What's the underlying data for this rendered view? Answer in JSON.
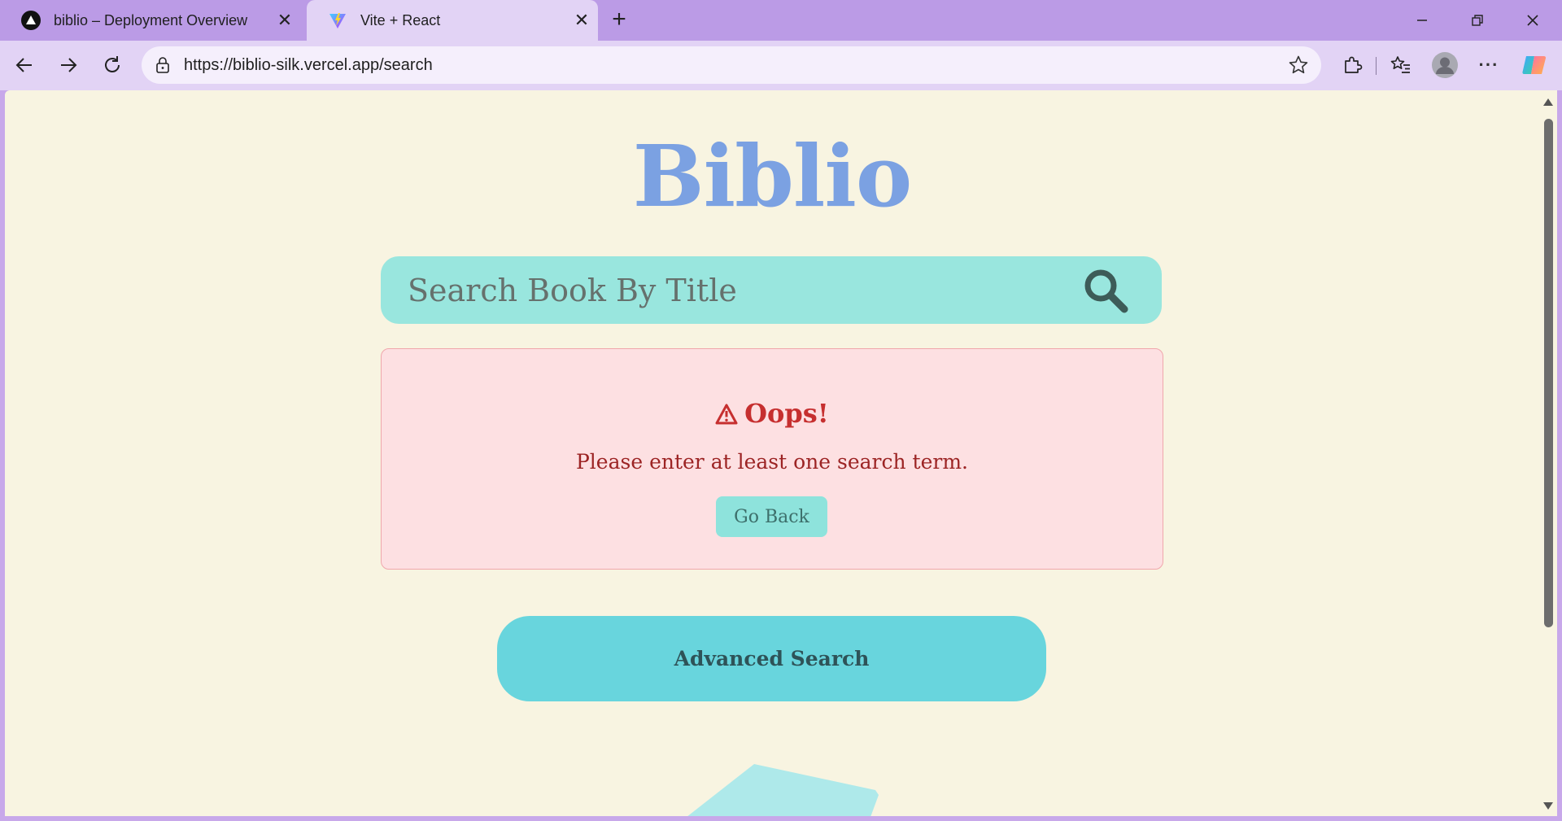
{
  "browser": {
    "tabs": [
      {
        "title": "biblio – Deployment Overview",
        "favicon": "vercel-triangle-icon",
        "active": false
      },
      {
        "title": "Vite + React",
        "favicon": "vite-icon",
        "active": true
      }
    ],
    "url": "https://biblio-silk.vercel.app/search"
  },
  "page": {
    "logo": "Biblio",
    "search": {
      "placeholder": "Search Book By Title",
      "value": ""
    },
    "error": {
      "title": "Oops!",
      "message": "Please enter at least one search term.",
      "button_label": "Go Back"
    },
    "advanced_search_label": "Advanced Search"
  },
  "colors": {
    "page_background": "#f8f4e1",
    "logo": "#7ba1e2",
    "search_bar": "#99e6de",
    "error_background": "#fde0e2",
    "error_text": "#c62f2f",
    "advanced_button": "#68d5dd",
    "browser_frame": "#bb9be6"
  }
}
